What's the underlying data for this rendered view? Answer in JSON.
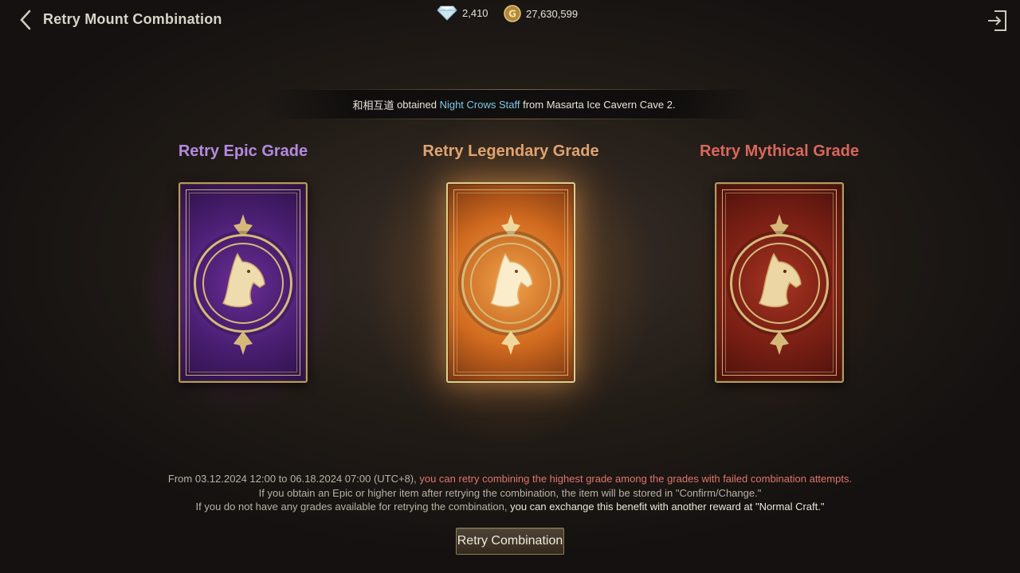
{
  "header": {
    "title": "Retry Mount Combination",
    "gems": "2,410",
    "gold": "27,630,599"
  },
  "banner": {
    "player": "和相互道",
    "text1": " obtained ",
    "item": "Night Crows Staff",
    "text2": " from Masarta Ice Cavern Cave 2."
  },
  "grades": [
    {
      "label": "Retry Epic Grade",
      "color": "#b48ae0"
    },
    {
      "label": "Retry Legendary Grade",
      "color": "#e0a472"
    },
    {
      "label": "Retry Mythical Grade",
      "color": "#d9675c"
    }
  ],
  "info": {
    "line1_a": "From 03.12.2024 12:00 to 06.18.2024 07:00 (UTC+8), ",
    "line1_b": "you can retry combining the highest grade among the grades with failed combination attempts",
    "line1_c": ".",
    "line2": "If you obtain an Epic or higher item after retrying the combination, the item will be stored in \"Confirm/Change.\"",
    "line3_a": "If you do not have any grades available for retrying the combination, ",
    "line3_b": "you can exchange this benefit with another reward at \"Normal Craft.\""
  },
  "retry_button": "Retry Combination",
  "icons": {
    "back": "chevron-left-icon",
    "gem": "diamond-icon",
    "gold": "gold-coin-icon",
    "exit": "exit-icon",
    "card": "horse-head-icon"
  }
}
